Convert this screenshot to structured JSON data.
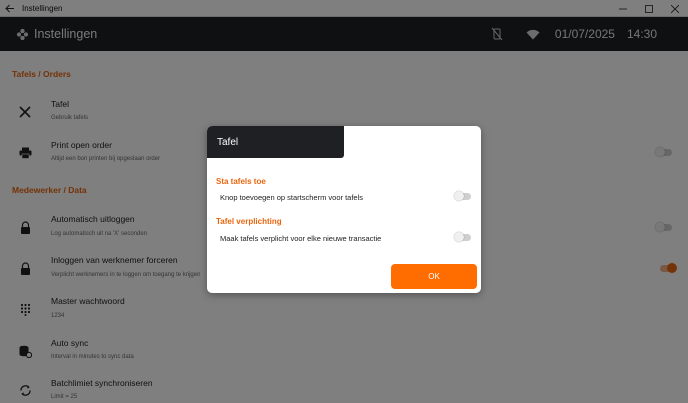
{
  "window": {
    "title": "Instellingen"
  },
  "appbar": {
    "title": "Instellingen",
    "date": "01/07/2025",
    "time": "14:30"
  },
  "sections": [
    {
      "title": "Tafels / Orders"
    },
    {
      "title": "Medewerker / Data"
    }
  ],
  "settings": [
    {
      "title": "Tafel",
      "subtitle": "Gebruik tafels",
      "icon": "cutlery-icon"
    },
    {
      "title": "Print open order",
      "subtitle": "Altijd een bon printen bij opgeslaan order",
      "icon": "printer-icon",
      "toggle": false
    },
    {
      "title": "Automatisch uitloggen",
      "subtitle": "Log automatisch uit na 'X' seconden",
      "icon": "lock-icon",
      "toggle": false
    },
    {
      "title": "Inloggen van werknemer forceren",
      "subtitle": "Verplicht werknemers in te loggen om toegang te krijgen",
      "icon": "lock-icon",
      "toggle": true
    },
    {
      "title": "Master wachtwoord",
      "subtitle": "1234",
      "icon": "keypad-icon"
    },
    {
      "title": "Auto sync",
      "subtitle": "Interval in minutes to sync data",
      "icon": "database-sync-icon"
    },
    {
      "title": "Batchlimiet synchroniseren",
      "subtitle": "Limit = 25",
      "icon": "sync-icon"
    }
  ],
  "dialog": {
    "title": "Tafel",
    "sections": [
      {
        "title": "Sta tafels toe",
        "option": "Knop toevoegen op startscherm voor tafels",
        "toggle": false
      },
      {
        "title": "Tafel verplichting",
        "option": "Maak tafels verplicht voor elke nieuwe transactie",
        "toggle": false
      }
    ],
    "ok_label": "OK"
  },
  "colors": {
    "accent": "#e8650e",
    "header_bg": "#1f2023",
    "button": "#ff6d00"
  }
}
